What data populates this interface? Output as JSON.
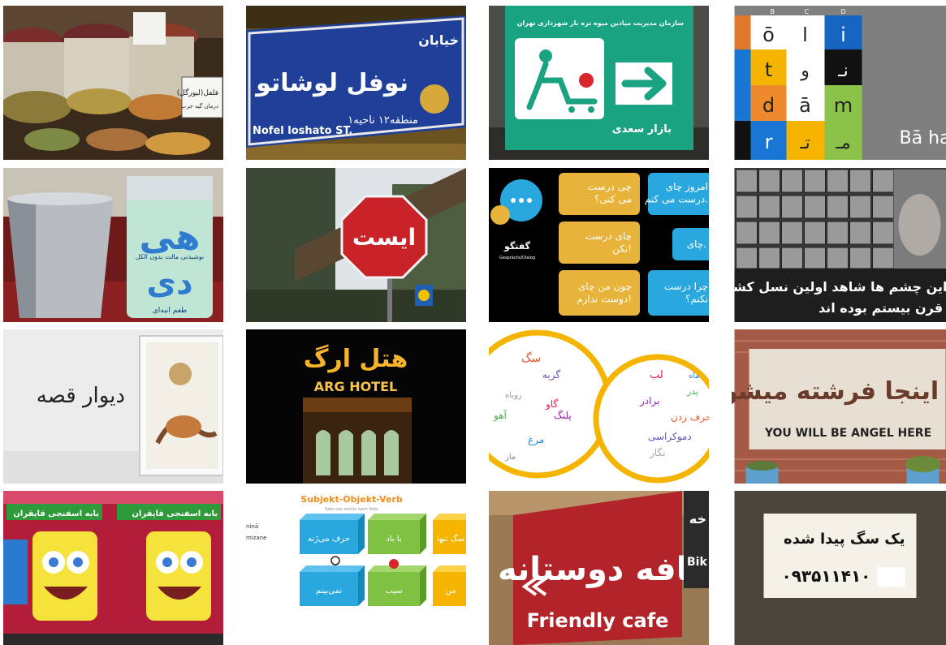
{
  "tiles": {
    "spices": {
      "sign_line1": "فلفل(ليورگل)",
      "sign_line2": "درمان گیه جرب"
    },
    "street_sign": {
      "top": "خیابان",
      "name": "نوفل لوشاتو",
      "latin": "Nofel loshato ST.",
      "district": "منطقه۱۲ ناحیه۱"
    },
    "market_sign": {
      "header": "سازمان مدیریت میادین میوه تره بار شهرداری تهران",
      "footer": "بازار سعدی"
    },
    "alphabet": {
      "col_b": "B",
      "col_c": "C",
      "col_d": "D",
      "cells": [
        "ō",
        "ا",
        "i",
        "t",
        "و",
        "نـ",
        "d",
        "ā",
        "m",
        "r",
        "تـ",
        "مـ"
      ],
      "caption": "Bā ha"
    },
    "can": {
      "big1": "هی",
      "big2": "دی",
      "subtitle": "نوشیدنی مالت بدون الکل",
      "bottom": "طعم انبه‌ای"
    },
    "stop_sign": {
      "text": "ایست"
    },
    "dialog": {
      "b1": "چی درست\nمی کنی؟",
      "b2": "امروز چای\nدرست می کنم.",
      "b3": "چای درست\nنکن!",
      "b4": "چای.",
      "b5": "چون من چای\nدوست ندارم!",
      "b6": "چرا درست\nنکنم؟",
      "label1": "گفتگو",
      "label2": "Gesprächs/Dialog"
    },
    "faces": {
      "line1": "این چشم ها شاهد اولین نسل کشی",
      "line2": "قرن بیستم بوده اند"
    },
    "wall": {
      "text": "دیوار قصه"
    },
    "hotel": {
      "name_fa": "هتل ارگ",
      "name_en": "ARG HOTEL"
    },
    "words": {
      "left": [
        "سگ",
        "گربه",
        "روباه",
        "گاو",
        "آهو",
        "پلنگ",
        "مرغ",
        "مار"
      ],
      "right": [
        "لب",
        "برادر",
        "حرف زدن",
        "دموکراسی",
        "نگار",
        "پدر",
        "ماه"
      ]
    },
    "angel": {
      "text_fa": "شما اینجا فرشته میشوید",
      "text_en": "YOU WILL BE ANGEL HERE"
    },
    "sponge": {
      "banner": "بابه اسفنجی قایقران"
    },
    "verbs": {
      "title": "Subjekt-Objekt-Verb",
      "subtitle": "Satz von rechts nach links",
      "left1": "ninā",
      "left2": "mizane",
      "b1": "حرف می‌زَنه",
      "b2": "با باد",
      "b3": "سگ تنها",
      "b4": "نمی‌بینم",
      "b5": "سیب",
      "b6": "من"
    },
    "cafe": {
      "text_fa": "کافه دوستانه",
      "text_en": "Friendly cafe",
      "side1": "خه",
      "side2": "Bik"
    },
    "dog": {
      "line1": "یک سگ پیدا شده",
      "phone": "۰۹۳۵۱۱۴۱۰"
    }
  },
  "colors": {
    "background": "#ffffff"
  }
}
